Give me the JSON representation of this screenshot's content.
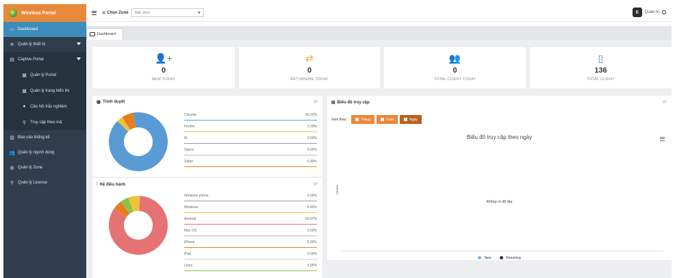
{
  "brand": {
    "title": "Wireless Portal"
  },
  "sidebar": {
    "items": [
      {
        "label": "Dashboard",
        "icon": "monitor-icon"
      },
      {
        "label": "Quản lý thiết bị",
        "icon": "wifi-icon"
      },
      {
        "label": "Captive Portal",
        "icon": "doc-icon"
      },
      {
        "label": "Quản lý Portal",
        "icon": "table-icon"
      },
      {
        "label": "Quản lý trang hiển thị",
        "icon": "table-icon"
      },
      {
        "label": "Câu hỏi trắc nghiệm",
        "icon": "question-icon"
      },
      {
        "label": "Truy cập theo mã",
        "icon": "key-icon"
      },
      {
        "label": "Báo cáo thống kê",
        "icon": "chart-icon"
      },
      {
        "label": "Quản lý người dùng",
        "icon": "users-icon"
      },
      {
        "label": "Quản lý Zone",
        "icon": "globe-icon"
      },
      {
        "label": "Quản lý License",
        "icon": "key-icon"
      }
    ]
  },
  "header": {
    "zone_label": "Chọn Zone",
    "zone_value": "Mặc định",
    "user_name": "Quản trị",
    "avatar_text": "B"
  },
  "tabs": [
    {
      "label": "Dashboard"
    }
  ],
  "stats": [
    {
      "value": "0",
      "label": "NEW TODAY",
      "color": "#2ea15a"
    },
    {
      "value": "0",
      "label": "RETURNING TODAY",
      "color": "#f0a030"
    },
    {
      "value": "0",
      "label": "TOTAL CLIENT TODAY",
      "color": "#e74c3c"
    },
    {
      "value": "136",
      "label": "TOTAL CLIENT",
      "color": "#3c8dbc"
    }
  ],
  "browser_panel": {
    "title": "Trình duyệt",
    "items": [
      {
        "name": "Chrome",
        "value": "90.22%",
        "color": "#5b9bd5"
      },
      {
        "name": "Firefox",
        "value": "3.29%",
        "color": "#f0c23a"
      },
      {
        "name": "IE",
        "value": "0.00%",
        "color": "#999999"
      },
      {
        "name": "Opera",
        "value": "0.00%",
        "color": "#bbbbbb"
      },
      {
        "name": "Safari",
        "value": "6.49%",
        "color": "#e67e22"
      }
    ]
  },
  "os_panel": {
    "title": "Hệ điều hành",
    "items": [
      {
        "name": "Windows phone",
        "value": "0.00%",
        "color": "#999999"
      },
      {
        "name": "Windows",
        "value": "6.49%",
        "color": "#f0c23a"
      },
      {
        "name": "Android",
        "value": "83.87%",
        "color": "#e57373"
      },
      {
        "name": "Mac OS",
        "value": "0.00%",
        "color": "#bbbbbb"
      },
      {
        "name": "iPhone",
        "value": "5.29%",
        "color": "#e67e22"
      },
      {
        "name": "iPad",
        "value": "0.00%",
        "color": "#cccccc"
      },
      {
        "name": "Linux",
        "value": "4.65%",
        "color": "#8bc34a"
      }
    ]
  },
  "access_panel": {
    "title": "Biểu đồ truy cập",
    "filter_label": "Xem theo:",
    "buttons": [
      "Tháng",
      "Tuần",
      "Ngày"
    ],
    "chart_title": "Biểu đồ truy cập theo ngày",
    "y_label": "Clients",
    "no_data": "Không có dữ liệu",
    "legend": [
      {
        "name": "New",
        "color": "#7cb5ec"
      },
      {
        "name": "Returning",
        "color": "#333333"
      }
    ]
  },
  "chart_data": [
    {
      "type": "pie",
      "title": "Trình duyệt",
      "categories": [
        "Chrome",
        "Firefox",
        "IE",
        "Opera",
        "Safari"
      ],
      "values": [
        90.22,
        3.29,
        0.0,
        0.0,
        6.49
      ]
    },
    {
      "type": "pie",
      "title": "Hệ điều hành",
      "categories": [
        "Windows phone",
        "Windows",
        "Android",
        "Mac OS",
        "iPhone",
        "iPad",
        "Linux"
      ],
      "values": [
        0.0,
        6.49,
        83.87,
        0.0,
        5.29,
        0.0,
        4.65
      ]
    },
    {
      "type": "line",
      "title": "Biểu đồ truy cập theo ngày",
      "ylabel": "Clients",
      "series": [
        {
          "name": "New",
          "values": []
        },
        {
          "name": "Returning",
          "values": []
        }
      ]
    }
  ]
}
